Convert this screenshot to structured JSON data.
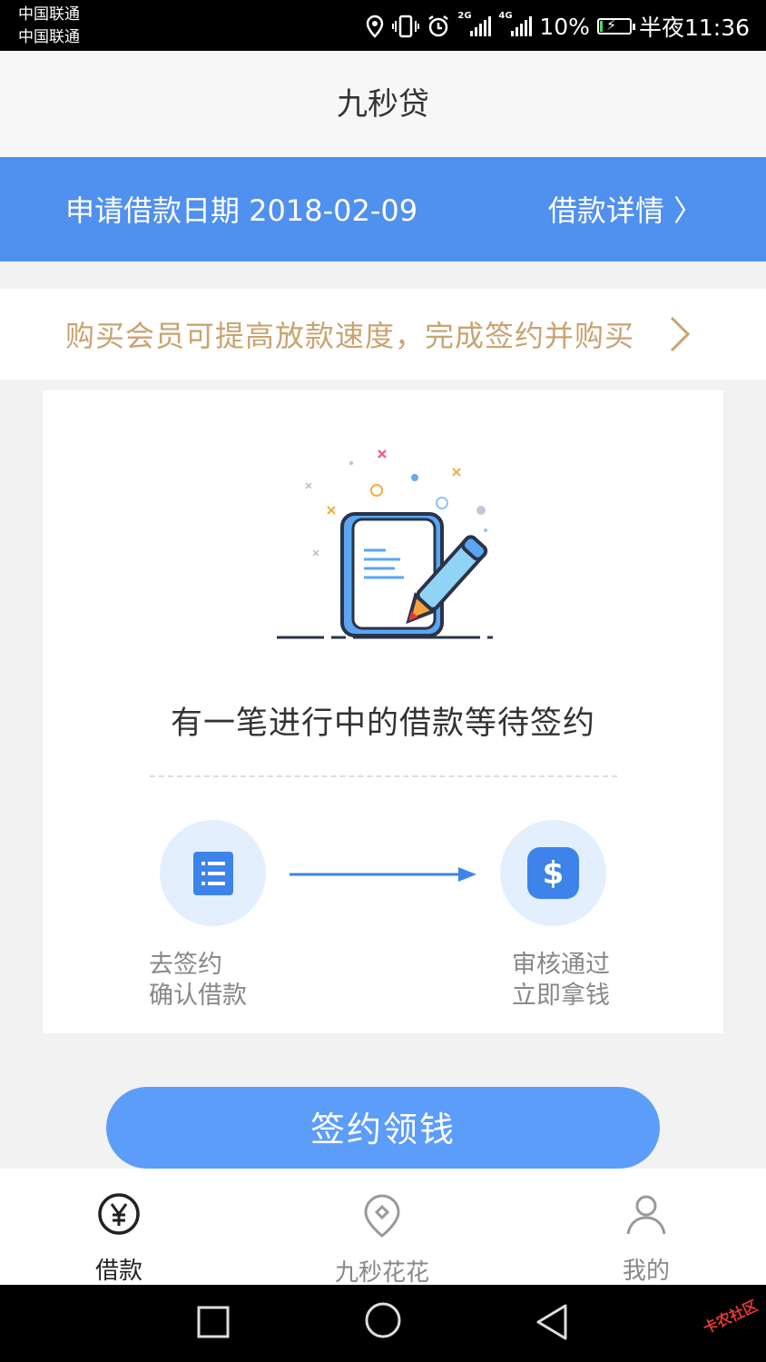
{
  "status_bar": {
    "carrier_1": "中国联通",
    "carrier_2": "中国联通",
    "network_1": "2G",
    "network_2": "4G",
    "battery_percent": "10%",
    "battery_level": 0.1,
    "time": "半夜11:36"
  },
  "header": {
    "title": "九秒贷"
  },
  "banner": {
    "date_text": "申请借款日期 2018-02-09",
    "detail_link": "借款详情 〉"
  },
  "promo": {
    "text": "购买会员可提高放款速度，完成签约并购买"
  },
  "card": {
    "title": "有一笔进行中的借款等待签约",
    "step1": {
      "line1": "去签约",
      "line2": "确认借款"
    },
    "step2": {
      "line1": "审核通过",
      "line2": "立即拿钱",
      "icon_text": "$"
    }
  },
  "sign_button": {
    "label": "签约领钱"
  },
  "tabs": [
    {
      "label": "借款",
      "icon": "yen-circle-icon",
      "active": true
    },
    {
      "label": "九秒花花",
      "icon": "location-pin-icon",
      "active": false
    },
    {
      "label": "我的",
      "icon": "person-icon",
      "active": false
    }
  ],
  "colors": {
    "primary_blue": "#5090ee",
    "promo_gold": "#c9a371",
    "button_blue": "#5c9dfa"
  },
  "watermark": "卡农社区"
}
